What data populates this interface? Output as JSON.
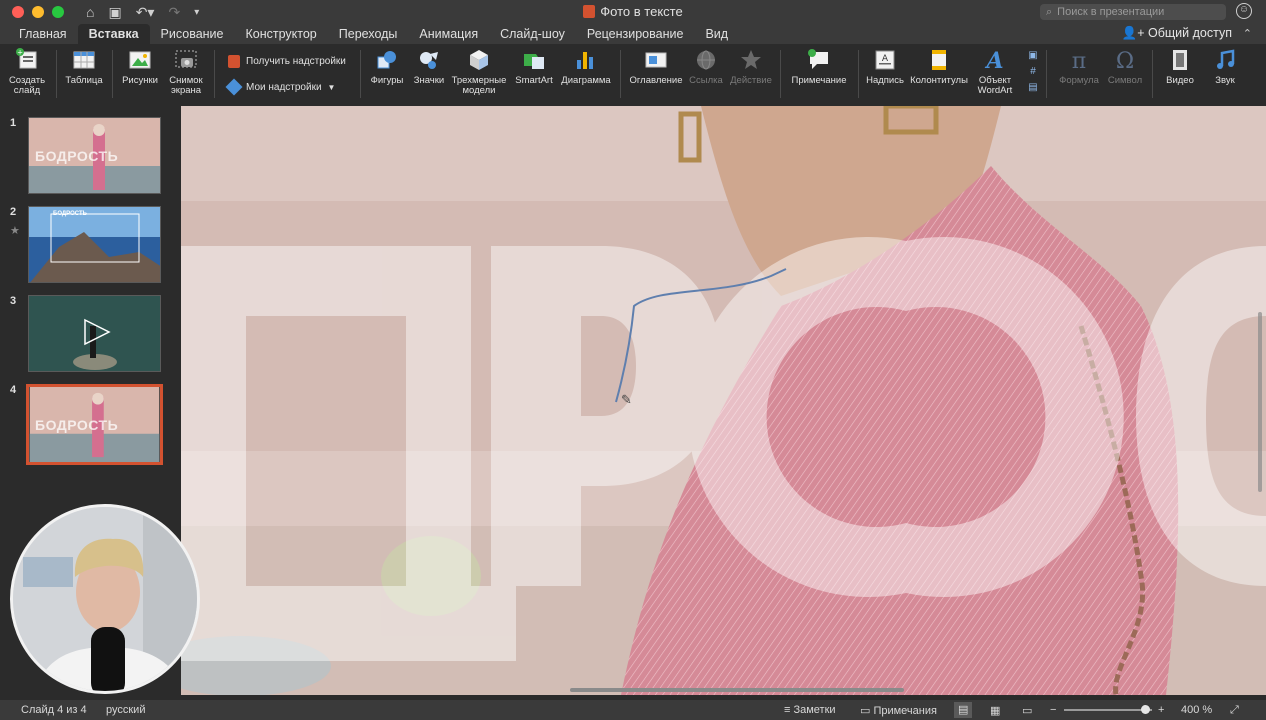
{
  "window": {
    "title": "Фото в тексте"
  },
  "search": {
    "placeholder": "Поиск в презентации"
  },
  "tabs": [
    {
      "label": "Главная"
    },
    {
      "label": "Вставка"
    },
    {
      "label": "Рисование"
    },
    {
      "label": "Конструктор"
    },
    {
      "label": "Переходы"
    },
    {
      "label": "Анимация"
    },
    {
      "label": "Слайд-шоу"
    },
    {
      "label": "Рецензирование"
    },
    {
      "label": "Вид"
    }
  ],
  "share_label": "Общий доступ",
  "ribbon": {
    "new_slide_l1": "Создать",
    "new_slide_l2": "слайд",
    "table": "Таблица",
    "pictures": "Рисунки",
    "screenshot_l1": "Снимок",
    "screenshot_l2": "экрана",
    "get_addins": "Получить надстройки",
    "my_addins": "Мои надстройки",
    "shapes": "Фигуры",
    "icons": "Значки",
    "models3d_l1": "Трехмерные",
    "models3d_l2": "модели",
    "smartart": "SmartArt",
    "chart": "Диаграмма",
    "toc": "Оглавление",
    "link": "Ссылка",
    "action": "Действие",
    "comment": "Примечание",
    "textbox": "Надпись",
    "headerfooter": "Колонтитулы",
    "wordart_l1": "Объект",
    "wordart_l2": "WordArt",
    "equation": "Формула",
    "symbol": "Символ",
    "video": "Видео",
    "audio": "Звук"
  },
  "thumbnails": [
    {
      "num": "1",
      "text": "БОДРОСТЬ"
    },
    {
      "num": "2",
      "text": "БОДРОСТЬ",
      "star": "★"
    },
    {
      "num": "3"
    },
    {
      "num": "4",
      "text": "БОДРОСТЬ"
    }
  ],
  "status": {
    "slide_info": "Слайд 4 из 4",
    "language": "русский",
    "notes": "Заметки",
    "comments": "Примечания",
    "zoom": "400 %"
  },
  "colors": {
    "accent": "#d35230",
    "slide_bg": "#d8c3bd",
    "shirt": "#d58a97"
  }
}
